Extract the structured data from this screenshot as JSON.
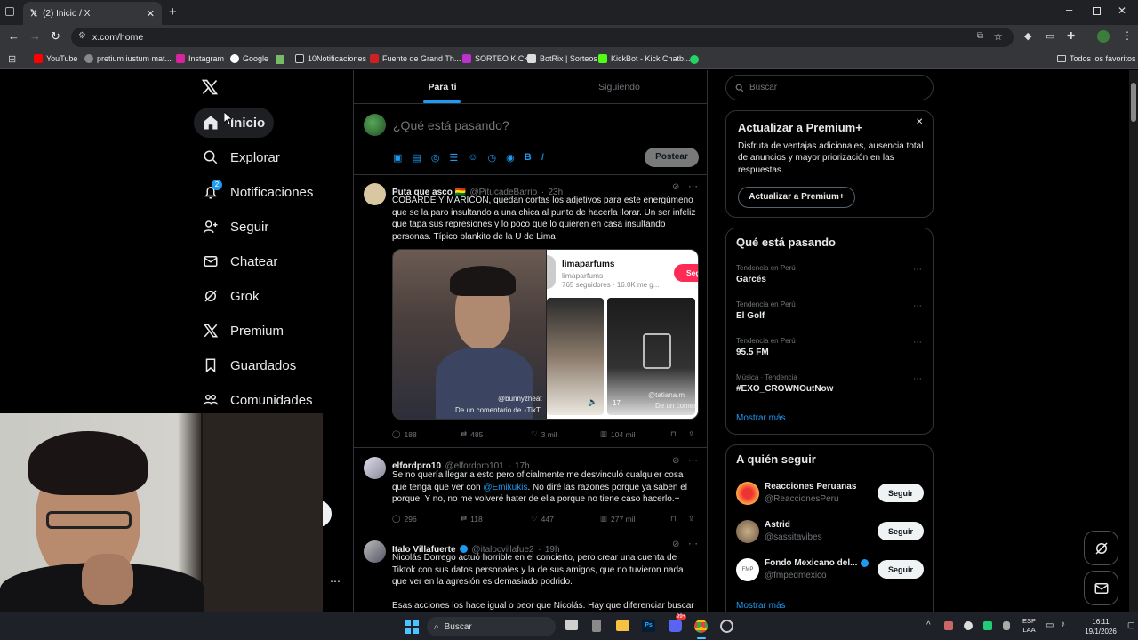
{
  "browser": {
    "tab_title": "(2) Inicio / X",
    "url": "x.com/home",
    "bookmarks": [
      "YouTube",
      "pretium iustum mat...",
      "Instagram",
      "Google",
      "10Notificaciones",
      "Fuente de Grand Th...",
      "SORTEO KICK",
      "BotRix | Sorteos",
      "KickBot - Kick Chatb..."
    ],
    "all_bookmarks": "Todos los favoritos"
  },
  "nav": {
    "items": [
      "Inicio",
      "Explorar",
      "Notificaciones",
      "Seguir",
      "Chatear",
      "Grok",
      "Premium",
      "Guardados",
      "Comunidades"
    ],
    "notif_badge": "2"
  },
  "feed": {
    "tabs": [
      "Para ti",
      "Siguiendo"
    ],
    "compose_placeholder": "¿Qué está pasando?",
    "post_button": "Postear"
  },
  "tweets": [
    {
      "name": "Puta que asco 🇧🇴",
      "handle": "@PitucadeBarrio",
      "time": "23h",
      "text": "COBARDE Y MARICON, quedan cortas los adjetivos para este energúmeno que se la paro insultando a una chica al punto de hacerla llorar. Un ser infeliz que tapa sus represiones y lo poco que lo quieren en casa insultando personas. Típico blankito de la U de Lima",
      "media": {
        "left_caption1": "@bunnyzheat",
        "left_caption2": "De un comentario de ♪TikT",
        "profile_name": "limaparfums",
        "profile_handle": "limaparfums",
        "profile_stats": "765 seguidores · 16.0K me g...",
        "follow_btn": "Seg",
        "thumb_likes": "17",
        "thumb_caption": "@tatiana.m",
        "thumb_caption2": "De un comentario de"
      },
      "replies": "188",
      "reposts": "485",
      "likes": "3 mil",
      "views": "104 mil"
    },
    {
      "name": "elfordpro10",
      "handle": "@elfordpro101",
      "time": "17h",
      "text_before": "Se no quería llegar a esto pero oficialmente me desvinculó cualquier cosa que tenga que ver con ",
      "mention": "@Emikukis",
      "text_after": ". No diré las razones porque ya saben el porque. Y no, no me volveré hater de ella porque no tiene caso hacerlo.+",
      "replies": "296",
      "reposts": "118",
      "likes": "447",
      "views": "277 mil"
    },
    {
      "name": "Italo Villafuerte",
      "handle": "@italocvillafue2",
      "time": "19h",
      "text": "Nicolás Dorrego actuó horrible en el concierto, pero crear una cuenta de Tiktok con sus datos personales y la de sus amigos, que no tuvieron nada que ver en la agresión es demasiado podrido.",
      "text2": "Esas acciones los hace igual o peor que Nicolás. Hay que diferenciar buscar"
    }
  ],
  "sidebar": {
    "search_placeholder": "Buscar",
    "premium": {
      "title": "Actualizar a Premium+",
      "body": "Disfruta de ventajas adicionales, ausencia total de anuncios y mayor priorización en las respuestas.",
      "button": "Actualizar a Premium+"
    },
    "trends_title": "Qué está pasando",
    "trends": [
      {
        "meta": "Tendencia en Perú",
        "name": "Garcés"
      },
      {
        "meta": "Tendencia en Perú",
        "name": "El Golf"
      },
      {
        "meta": "Tendencia en Perú",
        "name": "95.5 FM"
      },
      {
        "meta": "Música · Tendencia",
        "name": "#EXO_CROWNOutNow"
      }
    ],
    "show_more": "Mostrar más",
    "follow_title": "A quién seguir",
    "follow": [
      {
        "name": "Reacciones Peruanas",
        "handle": "@ReaccionesPeru",
        "button": "Seguir"
      },
      {
        "name": "Astrid",
        "handle": "@sassitavibes",
        "button": "Seguir"
      },
      {
        "name": "Fondo Mexicano del...",
        "handle": "@fmpedmexico",
        "button": "Seguir"
      }
    ],
    "show_more2": "Mostrar más"
  },
  "taskbar": {
    "search": "Buscar",
    "lang1": "ESP",
    "lang2": "LAA",
    "time": "16:11",
    "date": "19/1/2026",
    "badge": "99+"
  },
  "colors": {
    "accent": "#1d9bf0",
    "background": "#000000",
    "border": "#2f3336",
    "muted": "#71767b"
  }
}
